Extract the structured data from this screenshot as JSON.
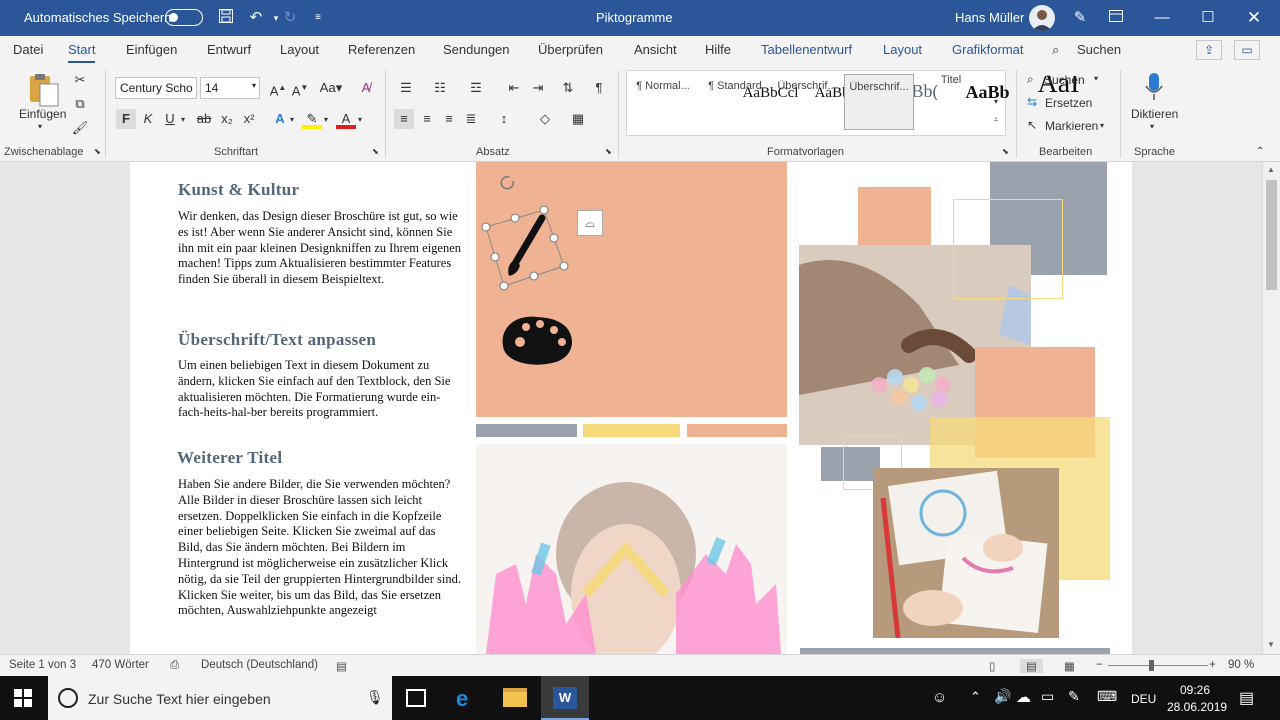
{
  "titlebar": {
    "autosave_label": "Automatisches Speichern",
    "doc_title": "Piktogramme",
    "user_name": "Hans Müller"
  },
  "tabs": [
    "Datei",
    "Start",
    "Einfügen",
    "Entwurf",
    "Layout",
    "Referenzen",
    "Sendungen",
    "Überprüfen",
    "Ansicht",
    "Hilfe",
    "Tabellenentwurf",
    "Layout",
    "Grafikformat"
  ],
  "tell_me": "Suchen",
  "ribbon": {
    "paste_label": "Einfügen",
    "font_name": "Century Scho",
    "font_size": "14",
    "font_case": "Aa",
    "bold": "F",
    "italic": "K",
    "underline": "U",
    "strike": "ab",
    "sub": "x₂",
    "sup": "x²",
    "groups": {
      "clipboard": "Zwischenablage",
      "font": "Schriftart",
      "paragraph": "Absatz",
      "styles": "Formatvorlagen",
      "editing": "Bearbeiten",
      "voice": "Sprache"
    },
    "styles": [
      {
        "preview": "AaBbCcl",
        "name": "¶ Normal..."
      },
      {
        "preview": "AaBbCcl",
        "name": "¶ Standard"
      },
      {
        "preview": "AaBb(",
        "name": "Überschrif..."
      },
      {
        "preview": "AaBb",
        "name": "Überschrif..."
      },
      {
        "preview": "AaI",
        "name": "Titel"
      }
    ],
    "editing": {
      "find": "Suchen",
      "replace": "Ersetzen",
      "select": "Markieren"
    },
    "dictate": "Diktieren"
  },
  "document": {
    "h1": "Kunst & Kultur",
    "p1": "Wir denken, das Design dieser Broschüre ist gut, so wie es ist! Aber wenn Sie anderer Ansicht sind, können Sie ihn mit ein paar kleinen Designkniffen zu Ihrem eigenen machen! Tipps zum Aktualisieren bestimmter Features finden Sie überall in diesem Beispieltext.",
    "h2": "Überschrift/Text anpassen",
    "p2": "Um einen beliebigen Text in diesem Dokument zu ändern, klicken Sie einfach auf den Textblock, den Sie aktualisieren möchten. Die Formatierung wurde ein-fach-heits-hal-ber bereits programmiert.",
    "h3": "Weiterer Titel",
    "p3": "Haben Sie andere Bilder, die Sie verwenden möchten? Alle Bilder in dieser Broschüre lassen sich leicht ersetzen. Doppelklicken Sie einfach in die Kopfzeile einer beliebigen Seite. Klicken Sie zweimal auf das Bild, das Sie ändern möchten. Bei Bildern im Hintergrund ist möglicherweise ein zusätzlicher Klick nötig, da sie Teil der gruppierten Hintergrundbilder sind. Klicken Sie weiter, bis um das Bild, das Sie ersetzen möchten, Auswahlziehpunkte angezeigt"
  },
  "statusbar": {
    "page": "Seite 1 von 3",
    "words": "470 Wörter",
    "language": "Deutsch (Deutschland)",
    "zoom": "90 %"
  },
  "taskbar": {
    "search_placeholder": "Zur Suche Text hier eingeben",
    "lang": "DEU",
    "time": "09:26",
    "date": "28.06.2019"
  },
  "colors": {
    "word_blue": "#2b579a",
    "salmon": "#efb394",
    "slate": "#9aa3ad",
    "yellow": "#f5d97a"
  }
}
